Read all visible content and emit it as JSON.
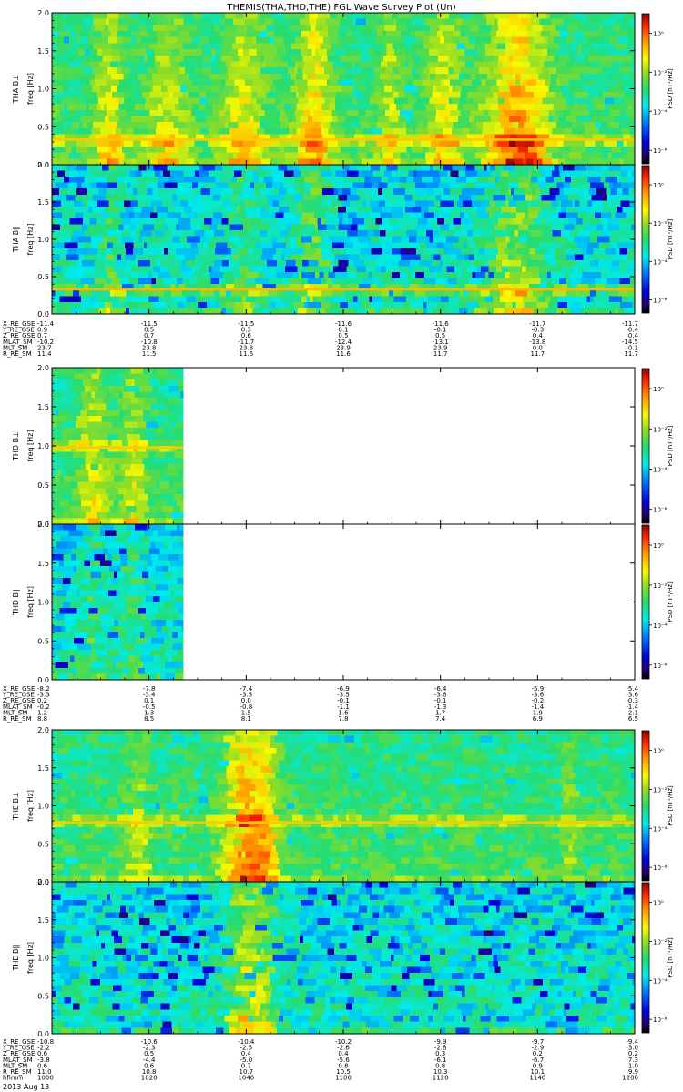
{
  "title": "THEMIS(THA,THD,THE) FGL Wave Survey Plot (Un)",
  "date_label": "2013 Aug 13",
  "colorbar_label": "PSD [nT²/Hz]",
  "freq_label": "freq [Hz]",
  "chart_data": {
    "type": "heatmap",
    "colormap": "rainbow-jet",
    "freq_axis": {
      "ylim": [
        0.0,
        2.0
      ],
      "ticks": [
        0.0,
        0.5,
        1.0,
        1.5,
        2.0
      ],
      "tick_labels": [
        "0.0",
        "0.5",
        "1.0",
        "1.5",
        "2.0"
      ]
    },
    "colorbar": {
      "scale": "log",
      "tick_labels": [
        "10⁰",
        "10⁻²",
        "10⁻⁴",
        "10⁻⁶"
      ]
    },
    "time_axis": {
      "label": "hhmm",
      "ticks": [
        "1000",
        "1020",
        "1040",
        "1100",
        "1120",
        "1140",
        "1200"
      ]
    },
    "probes": [
      {
        "id": "THA",
        "panels": [
          {
            "label": "THA B⊥",
            "data_end_fraction": 1.0,
            "narrowband_line_hz": 0.33,
            "bursts": [
              {
                "t": 0.1,
                "w": 0.025,
                "strength": 0.55
              },
              {
                "t": 0.2,
                "w": 0.035,
                "strength": 0.45
              },
              {
                "t": 0.33,
                "w": 0.035,
                "strength": 0.55
              },
              {
                "t": 0.45,
                "w": 0.03,
                "strength": 0.75
              },
              {
                "t": 0.58,
                "w": 0.02,
                "strength": 0.45
              },
              {
                "t": 0.67,
                "w": 0.03,
                "strength": 0.55
              },
              {
                "t": 0.8,
                "w": 0.05,
                "strength": 0.95
              }
            ]
          },
          {
            "label": "THA B∥",
            "data_end_fraction": 1.0,
            "narrowband_line_hz": 0.33,
            "bursts": [
              {
                "t": 0.1,
                "w": 0.02,
                "strength": 0.3
              },
              {
                "t": 0.33,
                "w": 0.025,
                "strength": 0.35
              },
              {
                "t": 0.45,
                "w": 0.025,
                "strength": 0.5
              },
              {
                "t": 0.8,
                "w": 0.05,
                "strength": 0.65
              }
            ]
          }
        ],
        "orbit": [
          {
            "label": "X_RE_GSE",
            "values": [
              "-11.4",
              "-11.5",
              "-11.5",
              "-11.6",
              "-11.6",
              "-11.7",
              "-11.7"
            ]
          },
          {
            "label": "Y_RE_GSE",
            "values": [
              "0.9",
              "0.5",
              "0.3",
              "0.1",
              "-0.1",
              "-0.3",
              "-0.4"
            ]
          },
          {
            "label": "Z_RE_GSE",
            "values": [
              "0.7",
              "0.7",
              "0.6",
              "0.5",
              "0.5",
              "0.4",
              "0.4"
            ]
          },
          {
            "label": "MLAT_SM",
            "values": [
              "-10.2",
              "-10.8",
              "-11.7",
              "-12.4",
              "-13.1",
              "-13.8",
              "-14.5"
            ]
          },
          {
            "label": "MLT_SM",
            "values": [
              "23.7",
              "23.8",
              "23.8",
              "23.9",
              "23.9",
              "0.0",
              "0.1"
            ]
          },
          {
            "label": "R_RE_SM",
            "values": [
              "11.4",
              "11.5",
              "11.6",
              "11.6",
              "11.7",
              "11.7",
              "11.7"
            ]
          }
        ]
      },
      {
        "id": "THD",
        "panels": [
          {
            "label": "THD B⊥",
            "data_end_fraction": 0.225,
            "narrowband_line_hz": 0.98,
            "bursts": [
              {
                "t": 0.07,
                "w": 0.025,
                "strength": 0.5
              },
              {
                "t": 0.14,
                "w": 0.02,
                "strength": 0.45
              }
            ]
          },
          {
            "label": "THD B∥",
            "data_end_fraction": 0.225,
            "narrowband_line_hz": null,
            "bursts": [
              {
                "t": 0.07,
                "w": 0.02,
                "strength": 0.3
              },
              {
                "t": 0.14,
                "w": 0.02,
                "strength": 0.3
              }
            ]
          }
        ],
        "orbit": [
          {
            "label": "X_RE_GSE",
            "values": [
              "-8.2",
              "-7.8",
              "-7.4",
              "-6.9",
              "-6.4",
              "-5.9",
              "-5.4"
            ]
          },
          {
            "label": "Y_RE_GSE",
            "values": [
              "-3.3",
              "-3.4",
              "-3.5",
              "-3.5",
              "-3.6",
              "-3.6",
              "-3.6"
            ]
          },
          {
            "label": "Z_RE_GSE",
            "values": [
              "0.2",
              "0.1",
              "0.0",
              "-0.1",
              "-0.1",
              "-0.2",
              "-0.3"
            ]
          },
          {
            "label": "MLAT_SM",
            "values": [
              "-0.2",
              "-0.5",
              "-0.8",
              "-1.1",
              "-1.3",
              "-1.4",
              "-1.4"
            ]
          },
          {
            "label": "MLT_SM",
            "values": [
              "1.2",
              "1.3",
              "1.5",
              "1.6",
              "1.7",
              "1.9",
              "2.1"
            ]
          },
          {
            "label": "R_RE_SM",
            "values": [
              "8.8",
              "8.5",
              "8.1",
              "7.8",
              "7.4",
              "6.9",
              "6.5"
            ]
          }
        ]
      },
      {
        "id": "THE",
        "panels": [
          {
            "label": "THE B⊥",
            "data_end_fraction": 1.0,
            "narrowband_line_hz": 0.78,
            "bursts": [
              {
                "t": 0.15,
                "w": 0.02,
                "strength": 0.4
              },
              {
                "t": 0.33,
                "w": 0.035,
                "strength": 0.9
              },
              {
                "t": 0.37,
                "w": 0.02,
                "strength": 0.55
              },
              {
                "t": 0.89,
                "w": 0.01,
                "strength": 0.3
              }
            ]
          },
          {
            "label": "THE B∥",
            "data_end_fraction": 1.0,
            "narrowband_line_hz": null,
            "bursts": [
              {
                "t": 0.33,
                "w": 0.03,
                "strength": 0.75
              },
              {
                "t": 0.37,
                "w": 0.02,
                "strength": 0.4
              }
            ]
          }
        ],
        "orbit": [
          {
            "label": "X_RE_GSE",
            "values": [
              "-10.8",
              "-10.6",
              "-10.4",
              "-10.2",
              "-9.9",
              "-9.7",
              "-9.4"
            ]
          },
          {
            "label": "Y_RE_GSE",
            "values": [
              "-2.2",
              "-2.3",
              "-2.5",
              "-2.6",
              "-2.8",
              "-2.9",
              "-3.0"
            ]
          },
          {
            "label": "Z_RE_GSE",
            "values": [
              "0.6",
              "0.5",
              "0.4",
              "0.4",
              "0.3",
              "0.2",
              "0.2"
            ]
          },
          {
            "label": "MLAT_SM",
            "values": [
              "-3.8",
              "-4.4",
              "-5.0",
              "-5.6",
              "-6.1",
              "-6.7",
              "-7.3"
            ]
          },
          {
            "label": "MLT_SM",
            "values": [
              "0.6",
              "0.6",
              "0.7",
              "0.8",
              "0.8",
              "0.9",
              "1.0"
            ]
          },
          {
            "label": "R_RE_SM",
            "values": [
              "11.0",
              "10.8",
              "10.7",
              "10.5",
              "10.3",
              "10.1",
              "9.9"
            ]
          },
          {
            "label": "hhmm",
            "values": [
              "1000",
              "1020",
              "1040",
              "1100",
              "1120",
              "1140",
              "1200"
            ]
          }
        ]
      }
    ]
  }
}
